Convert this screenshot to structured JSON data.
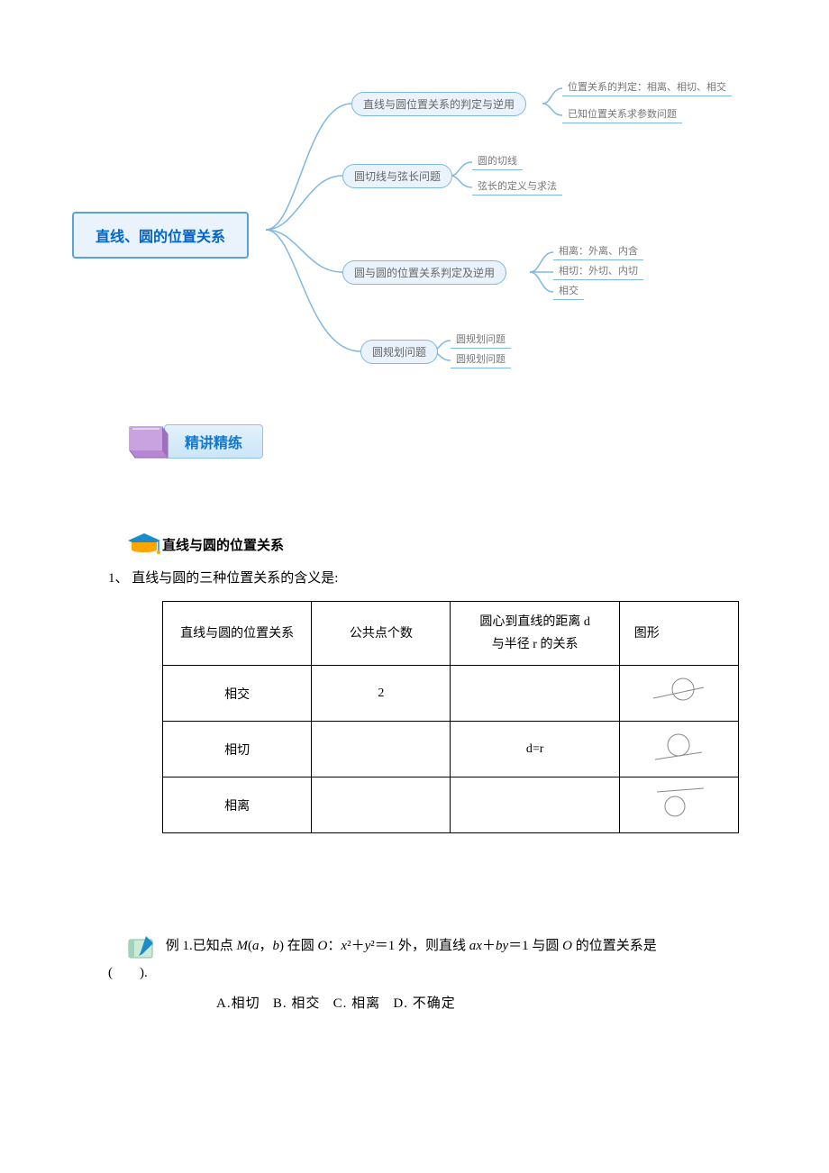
{
  "mindmap": {
    "root": "直线、圆的位置关系",
    "nodes": {
      "n1": "直线与圆位置关系的判定与逆用",
      "n2": "圆切线与弦长问题",
      "n3": "圆与圆的位置关系判定及逆用",
      "n4": "圆规划问题"
    },
    "leaves": {
      "l1a": "位置关系的判定：相离、相切、相交",
      "l1b": "已知位置关系求参数问题",
      "l2a": "圆的切线",
      "l2b": "弦长的定义与求法",
      "l3a": "相离：外离、内含",
      "l3b": "相切：外切、内切",
      "l3c": "相交",
      "l4a": "圆规划问题",
      "l4b": "圆规划问题"
    }
  },
  "section_label": "精讲精练",
  "subsection_title": "直线与圆的位置关系",
  "numbered_text": "1、 直线与圆的三种位置关系的含义是:",
  "table": {
    "headers": {
      "c1": "直线与圆的位置关系",
      "c2": "公共点个数",
      "c3a": "圆心到直线的距离 d",
      "c3b": "与半径 r 的关系",
      "c4": "图形"
    },
    "rows": [
      {
        "c1": "相交",
        "c2": "2",
        "c3": "",
        "diag": "intersect"
      },
      {
        "c1": "相切",
        "c2": "",
        "c3": "d=r",
        "diag": "tangent"
      },
      {
        "c1": "相离",
        "c2": "",
        "c3": "",
        "diag": "separate"
      }
    ]
  },
  "example": {
    "label": "例 1.",
    "stem_pre": "已知点 ",
    "m": "M",
    "ab_paren_pre": "(",
    "a": "a",
    "comma": "，",
    "b": "b",
    "ab_paren_post": ") 在圆 ",
    "o1": "O",
    "colon": "：",
    "eq_lhs_x": "x",
    "sq1": "²",
    "plus": "＋",
    "eq_lhs_y": "y",
    "sq2": "²",
    "eq_rhs": "＝1 外，则直线 ",
    "ax": "ax",
    "by": "by",
    "eq_end": "＝1 与圆 ",
    "o2": "O",
    "tail": " 的位置关系是",
    "paren": "(　　).",
    "options": {
      "a": "A.相切",
      "b": "B. 相交",
      "c": "C. 相离",
      "d": "D. 不确定"
    }
  }
}
